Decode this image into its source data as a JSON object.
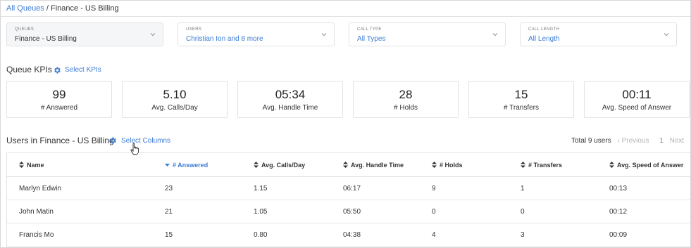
{
  "breadcrumb": {
    "parent": "All Queues",
    "separator": "/",
    "current": "Finance - US Billing"
  },
  "filters": [
    {
      "label": "QUEUES",
      "value": "Finance - US Billing",
      "blue": false
    },
    {
      "label": "USERS",
      "value": "Christian Ion and 8 more",
      "blue": true
    },
    {
      "label": "CALL TYPE",
      "value": "All Types",
      "blue": true
    },
    {
      "label": "CALL LENGTH",
      "value": "All Length",
      "blue": true
    }
  ],
  "kpi_section": {
    "title": "Queue KPIs",
    "select_label": "Select KPIs"
  },
  "kpis": [
    {
      "value": "99",
      "label": "# Answered"
    },
    {
      "value": "5.10",
      "label": "Avg. Calls/Day"
    },
    {
      "value": "05:34",
      "label": "Avg. Handle Time"
    },
    {
      "value": "28",
      "label": "# Holds"
    },
    {
      "value": "15",
      "label": "# Transfers"
    },
    {
      "value": "00:11",
      "label": "Avg. Speed of Answer"
    }
  ],
  "users_section": {
    "title": "Users in Finance - US Billing",
    "select_label": "Select Columns"
  },
  "pagination": {
    "total": "Total 9 users",
    "previous": "Previous",
    "page": "1",
    "next": "Next"
  },
  "table": {
    "columns": [
      "Name",
      "# Answered",
      "Avg. Calls/Day",
      "Avg. Handle Time",
      "# Holds",
      "# Transfers",
      "Avg. Speed of Answer"
    ],
    "sorted_column": "# Answered",
    "rows": [
      [
        "Marlyn Edwin",
        "23",
        "1.15",
        "06:17",
        "9",
        "1",
        "00:13"
      ],
      [
        "John Matin",
        "21",
        "1.05",
        "05:50",
        "0",
        "0",
        "00:12"
      ],
      [
        "Francis Mo",
        "15",
        "0.80",
        "04:38",
        "4",
        "3",
        "00:09"
      ]
    ]
  },
  "colors": {
    "accent": "#3a7bd5",
    "border": "#e2e2e2"
  }
}
